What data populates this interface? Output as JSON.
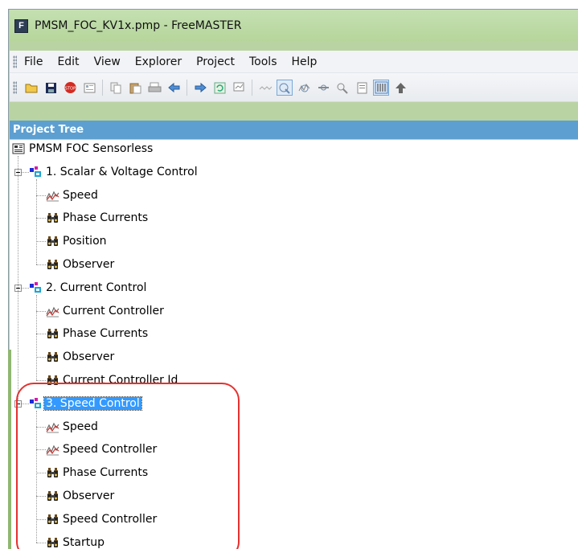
{
  "window": {
    "title": "PMSM_FOC_KV1x.pmp - FreeMASTER",
    "app_icon_letter": "F"
  },
  "menu": {
    "items": [
      {
        "label": "File",
        "name": "file"
      },
      {
        "label": "Edit",
        "name": "edit"
      },
      {
        "label": "View",
        "name": "view"
      },
      {
        "label": "Explorer",
        "name": "explorer"
      },
      {
        "label": "Project",
        "name": "project"
      },
      {
        "label": "Tools",
        "name": "tools"
      },
      {
        "label": "Help",
        "name": "help"
      }
    ]
  },
  "toolbar": {
    "icons": [
      "open-folder-icon",
      "save-icon",
      "stop-icon",
      "properties-icon",
      "copy-icon",
      "paste-icon",
      "print-icon",
      "back-arrow-icon",
      "forward-arrow-icon",
      "refresh-icon",
      "watch-icon",
      "oscilloscope-icon",
      "variable-watch-icon",
      "recorder-icon",
      "pipe-icon",
      "scope-settings-icon",
      "document-icon",
      "grid-icon",
      "up-arrow-icon"
    ]
  },
  "panel": {
    "header": "Project Tree"
  },
  "tree": {
    "root": {
      "label": "PMSM FOC Sensorless",
      "icon": "project-icon"
    },
    "groups": [
      {
        "label": "1. Scalar & Voltage Control",
        "selected": false,
        "children": [
          {
            "label": "Speed",
            "icon": "recorder-icon"
          },
          {
            "label": "Phase Currents",
            "icon": "oscilloscope-icon"
          },
          {
            "label": "Position",
            "icon": "oscilloscope-icon"
          },
          {
            "label": "Observer",
            "icon": "oscilloscope-icon"
          }
        ]
      },
      {
        "label": "2. Current Control",
        "selected": false,
        "children": [
          {
            "label": "Current Controller",
            "icon": "recorder-icon"
          },
          {
            "label": "Phase Currents",
            "icon": "oscilloscope-icon"
          },
          {
            "label": "Observer",
            "icon": "oscilloscope-icon"
          },
          {
            "label": "Current Controller Id",
            "icon": "oscilloscope-icon"
          }
        ]
      },
      {
        "label": "3. Speed Control",
        "selected": true,
        "children": [
          {
            "label": "Speed",
            "icon": "recorder-icon"
          },
          {
            "label": "Speed Controller",
            "icon": "recorder-icon"
          },
          {
            "label": "Phase Currents",
            "icon": "oscilloscope-icon"
          },
          {
            "label": "Observer",
            "icon": "oscilloscope-icon"
          },
          {
            "label": "Speed Controller",
            "icon": "oscilloscope-icon"
          },
          {
            "label": "Startup",
            "icon": "oscilloscope-icon"
          }
        ]
      }
    ]
  },
  "colors": {
    "title_bar": "#b6d59b",
    "panel_header": "#5d9fd0",
    "selection": "#3399ff",
    "highlight_ring": "#e5312f"
  }
}
